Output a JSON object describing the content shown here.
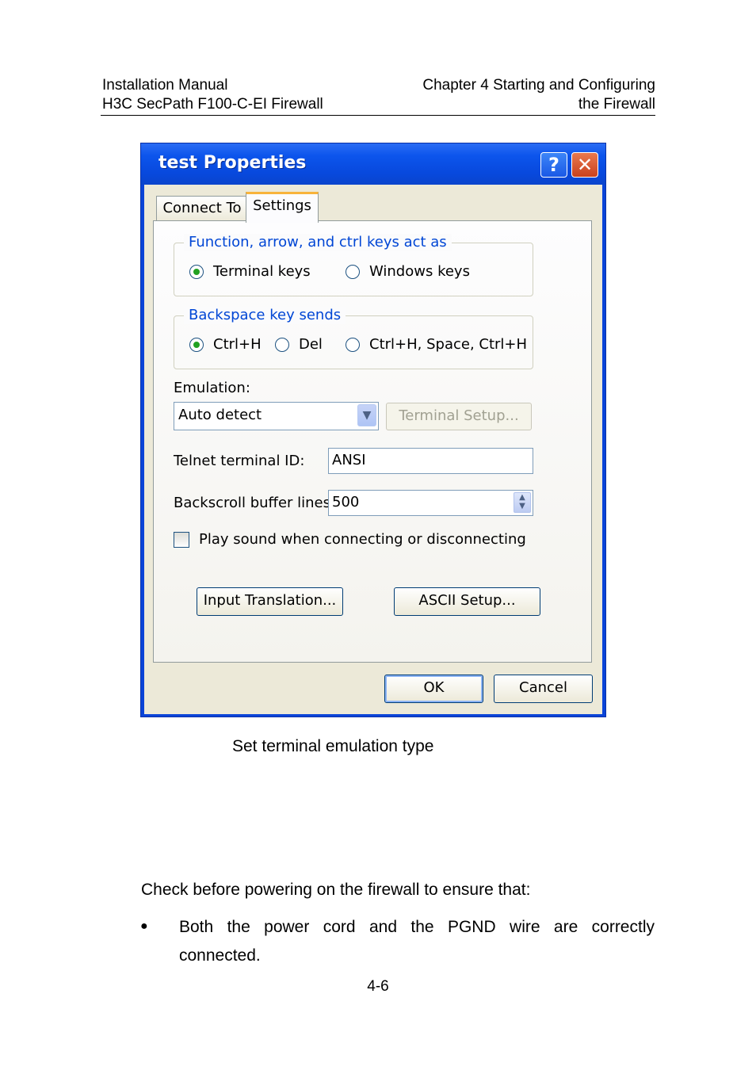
{
  "header": {
    "left_line1": "Installation Manual",
    "left_line2": "H3C SecPath F100-C-EI Firewall",
    "right_line1": "Chapter 4  Starting and Configuring",
    "right_line2": "the Firewall"
  },
  "dialog": {
    "title": "test Properties",
    "help_glyph": "?",
    "close_glyph": "✕",
    "tabs": [
      {
        "label": "Connect To",
        "active": false
      },
      {
        "label": "Settings",
        "active": true
      }
    ],
    "function_keys_group": {
      "legend": "Function, arrow, and ctrl keys act as",
      "options": [
        {
          "label": "Terminal keys",
          "selected": true
        },
        {
          "label": "Windows keys",
          "selected": false
        }
      ]
    },
    "backspace_group": {
      "legend": "Backspace key sends",
      "options": [
        {
          "label": "Ctrl+H",
          "selected": true
        },
        {
          "label": "Del",
          "selected": false
        },
        {
          "label": "Ctrl+H, Space, Ctrl+H",
          "selected": false
        }
      ]
    },
    "emulation": {
      "label": "Emulation:",
      "value": "Auto detect",
      "terminal_setup_label": "Terminal Setup..."
    },
    "telnet_id": {
      "label": "Telnet terminal ID:",
      "value": "ANSI"
    },
    "backscroll": {
      "label": "Backscroll buffer lines:",
      "value": "500"
    },
    "play_sound": {
      "label": "Play sound when connecting or disconnecting",
      "checked": false
    },
    "input_translation_label": "Input Translation...",
    "ascii_setup_label": "ASCII Setup...",
    "ok_label": "OK",
    "cancel_label": "Cancel"
  },
  "caption": "Set terminal emulation type",
  "body": {
    "paragraph": "Check before powering on the firewall to ensure that:",
    "bullet_glyph": "●",
    "bullets": [
      "Both the power cord and the PGND wire are correctly connected."
    ]
  },
  "page_number": "4-6"
}
